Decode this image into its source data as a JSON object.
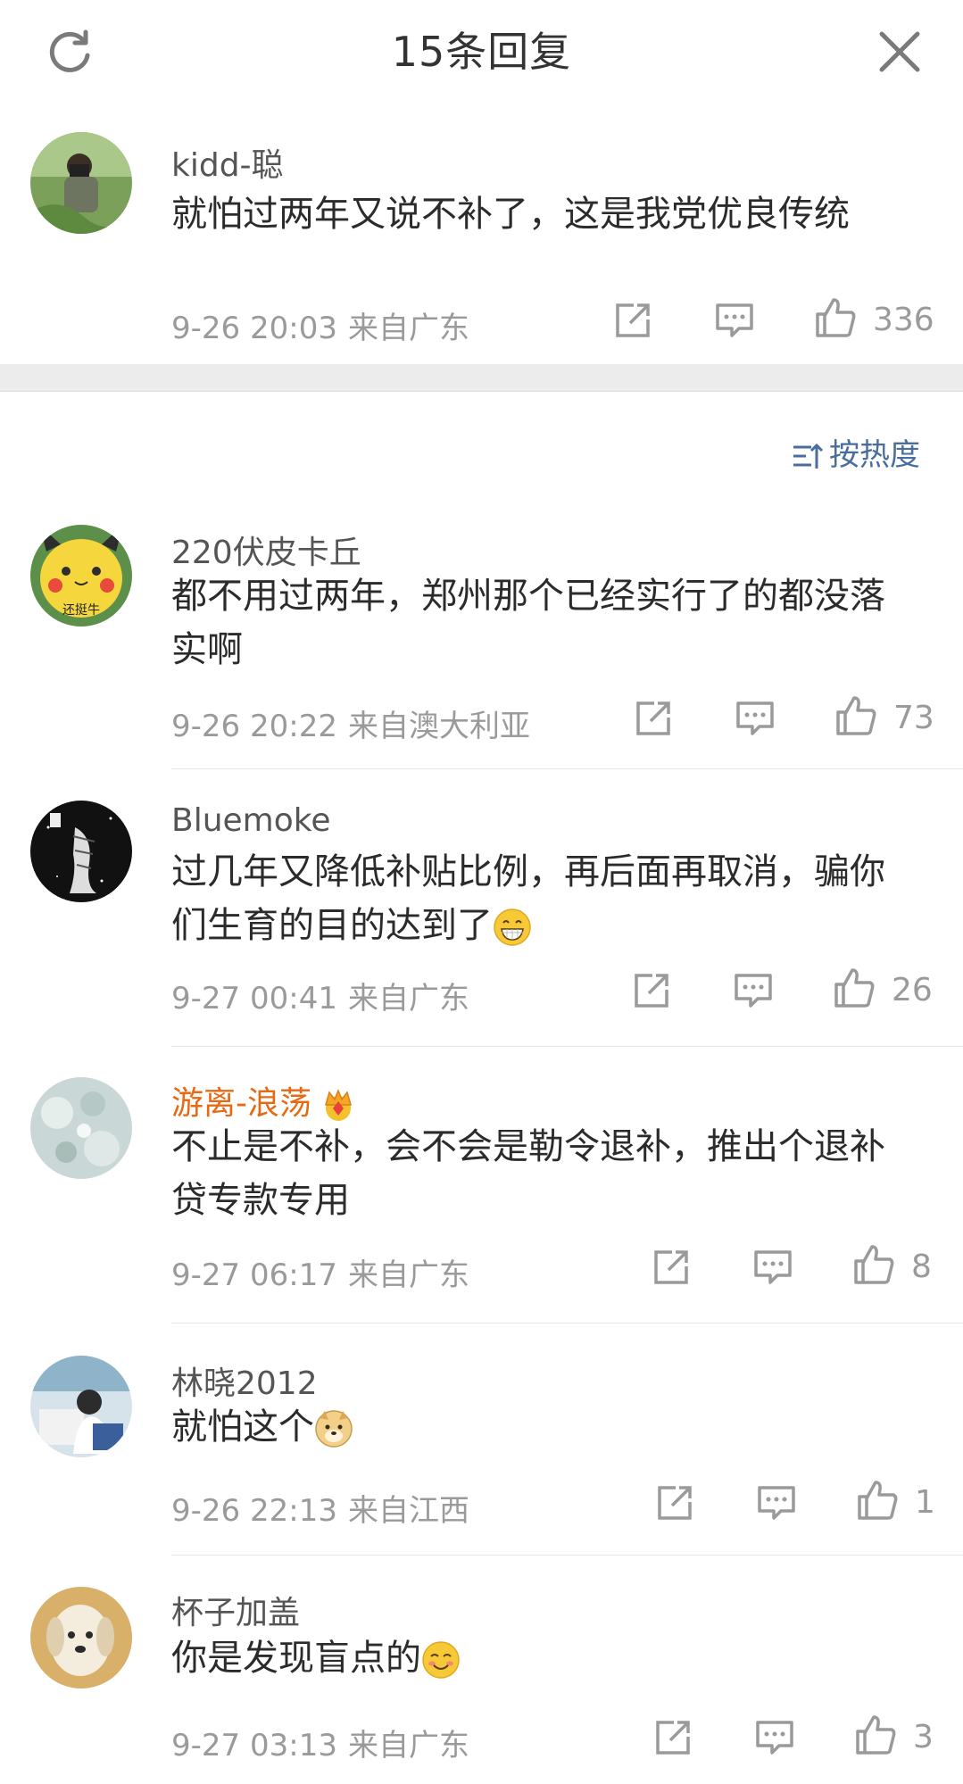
{
  "header": {
    "title": "15条回复"
  },
  "main": {
    "username": "kidd-聪",
    "content": "就怕过两年又说不补了，这是我党优良传统",
    "date": "9-26 20:03",
    "location": "来自广东",
    "likes": "336"
  },
  "sort": {
    "label": "按热度"
  },
  "replies": [
    {
      "username": "220伏皮卡丘",
      "content": "都不用过两年，郑州那个已经实行了的都没落实啊",
      "date": "9-26 20:22",
      "location": "来自澳大利亚",
      "likes": "73",
      "avatar_text": "还挺牛"
    },
    {
      "username": "Bluemoke",
      "content": "过几年又降低补贴比例，再后面再取消，骗你们生育的目的达到了",
      "date": "9-27 00:41",
      "location": "来自广东",
      "likes": "26"
    },
    {
      "username": "游离-浪荡",
      "content": "不止是不补，会不会是勒令退补，推出个退补贷专款专用",
      "date": "9-27 06:17",
      "location": "来自广东",
      "likes": "8"
    },
    {
      "username": "林晓2012",
      "content": "就怕这个",
      "date": "9-26 22:13",
      "location": "来自江西",
      "likes": "1"
    },
    {
      "username": "杯子加盖",
      "content": "你是发现盲点的",
      "date": "9-27 03:13",
      "location": "来自广东",
      "likes": "3"
    }
  ],
  "icons": {
    "refresh": "refresh-icon",
    "close": "close-icon",
    "share": "share-icon",
    "comment": "comment-icon",
    "like": "like-icon",
    "sort": "sort-icon",
    "crown": "crown-icon",
    "grin": "grin-emoji-icon",
    "doge": "doge-emoji-icon",
    "smile": "smile-emoji-icon"
  },
  "colors": {
    "accent": "#4a6d9f",
    "vip": "#e66a13",
    "meta": "#9a9a9a"
  }
}
